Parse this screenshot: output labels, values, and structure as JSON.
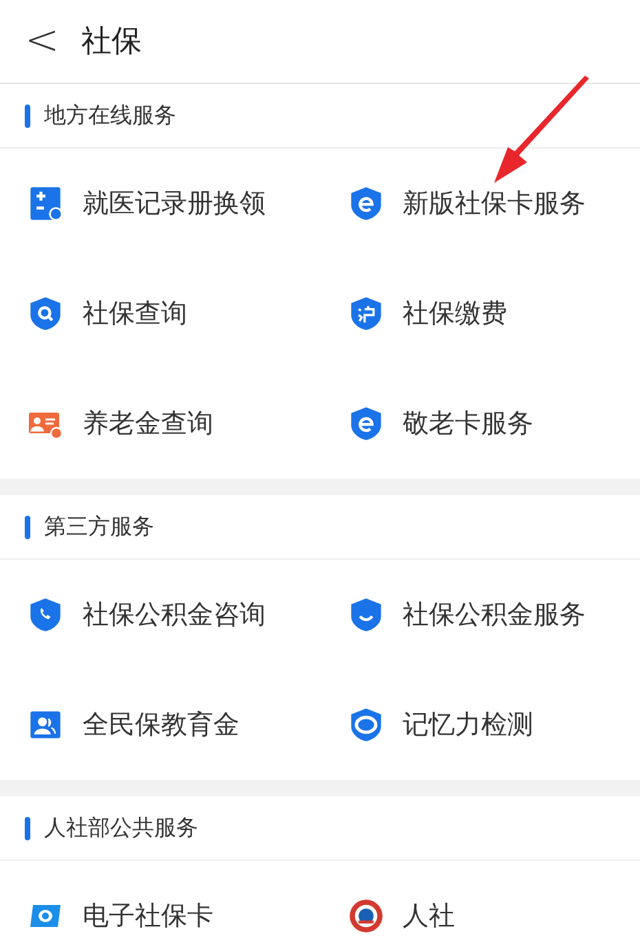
{
  "header": {
    "back": "<",
    "title": "社保"
  },
  "sections": [
    {
      "title": "地方在线服务",
      "items": [
        {
          "label": "就医记录册换领",
          "kind": "record-book"
        },
        {
          "label": "新版社保卡服务",
          "kind": "shield-e"
        },
        {
          "label": "社保查询",
          "kind": "shield-search"
        },
        {
          "label": "社保缴费",
          "kind": "shield-hu"
        },
        {
          "label": "养老金查询",
          "kind": "pension-card"
        },
        {
          "label": "敬老卡服务",
          "kind": "shield-e"
        }
      ]
    },
    {
      "title": "第三方服务",
      "items": [
        {
          "label": "社保公积金咨询",
          "kind": "shield-phone"
        },
        {
          "label": "社保公积金服务",
          "kind": "shield-smile"
        },
        {
          "label": "全民保教育金",
          "kind": "people-card"
        },
        {
          "label": "记忆力检测",
          "kind": "shield-ring"
        }
      ]
    },
    {
      "title": "人社部公共服务",
      "items": [
        {
          "label": "电子社保卡",
          "kind": "si-card"
        },
        {
          "label": "人社",
          "kind": "emblem"
        }
      ]
    }
  ],
  "annotation": {
    "kind": "arrow"
  }
}
